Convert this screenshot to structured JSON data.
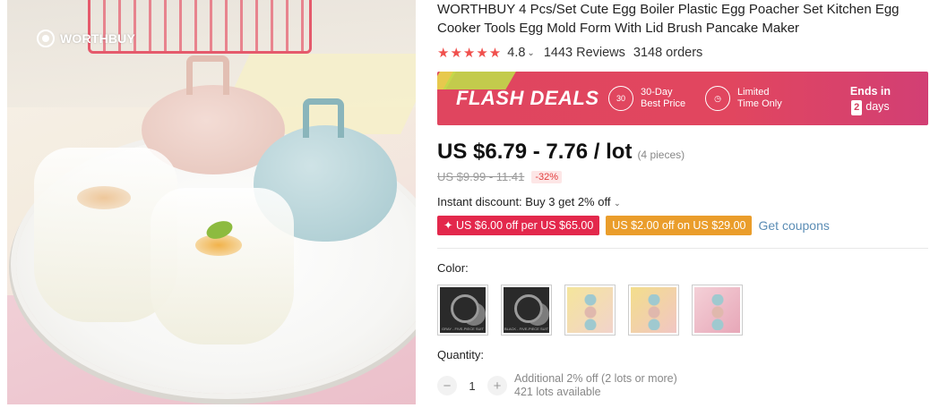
{
  "brand": {
    "logo_text": "WORTHBUY"
  },
  "product": {
    "title": "WORTHBUY 4 Pcs/Set Cute Egg Boiler Plastic Egg Poacher Set Kitchen Egg Cooker Tools Egg Mold Form With Lid Brush Pancake Maker",
    "rating": "4.8",
    "stars": "★★★★★",
    "reviews": "1443 Reviews",
    "orders": "3148 orders"
  },
  "flash": {
    "label": "FLASH DEALS",
    "feature1_icon_text": "30",
    "feature1_l1": "30-Day",
    "feature1_l2": "Best Price",
    "feature2_l1": "Limited",
    "feature2_l2": "Time Only",
    "ends_label": "Ends in",
    "ends_value": "2",
    "ends_unit": "days",
    "colors": {
      "bg": "#e0455f",
      "accent": "#c0d94a"
    }
  },
  "price": {
    "current": "US $6.79 - 7.76 / lot",
    "pieces": "(4 pieces)",
    "original": "US $9.99 - 11.41",
    "discount": "-32%"
  },
  "promo": {
    "instant": "Instant discount: Buy 3 get 2% off",
    "coupon1": "✦ US $6.00 off per US $65.00",
    "coupon2": "US $2.00 off on US $29.00",
    "get_coupons": "Get coupons"
  },
  "color": {
    "label": "Color:",
    "swatches": [
      {
        "name": "dark-black",
        "caption": "GRAY - FIVE-PIECE SUIT"
      },
      {
        "name": "dark-black-2",
        "caption": "BLACK - FIVE-PIECE SUIT"
      },
      {
        "name": "yellow-pink"
      },
      {
        "name": "yellow-pink-2"
      },
      {
        "name": "pink-blue"
      }
    ]
  },
  "quantity": {
    "label": "Quantity:",
    "value": "1",
    "minus": "−",
    "plus": "+",
    "note1": "Additional 2% off (2 lots or more)",
    "note2": "421 lots available"
  }
}
